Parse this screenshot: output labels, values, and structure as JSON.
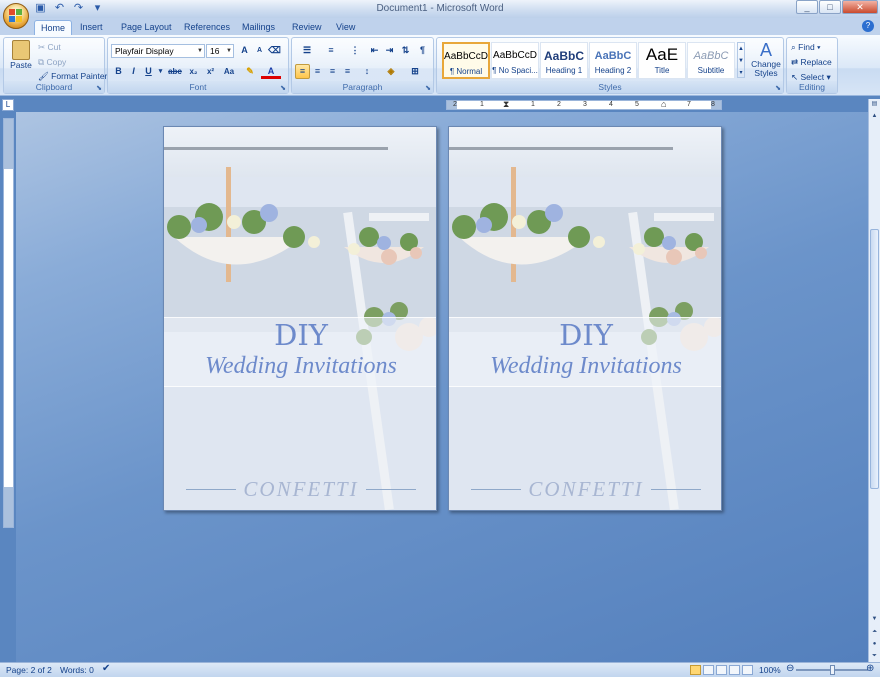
{
  "window": {
    "title": "Document1 - Microsoft Word",
    "controls": [
      "_",
      "□",
      "✕"
    ]
  },
  "quick_access": {
    "save_icon": "save-icon",
    "undo_icon": "undo-icon",
    "redo_icon": "redo-icon",
    "more": "▾"
  },
  "tabs": [
    {
      "label": "Home",
      "active": true
    },
    {
      "label": "Insert"
    },
    {
      "label": "Page Layout"
    },
    {
      "label": "References"
    },
    {
      "label": "Mailings"
    },
    {
      "label": "Review"
    },
    {
      "label": "View"
    }
  ],
  "ribbon": {
    "clipboard": {
      "label": "Clipboard",
      "paste": "Paste",
      "cut": "Cut",
      "copy": "Copy",
      "format_painter": "Format Painter"
    },
    "font": {
      "label": "Font",
      "font_name": "Playfair Display",
      "font_size": "16",
      "bold": "B",
      "italic": "I",
      "underline": "U",
      "strike": "abc",
      "subscript": "x₂",
      "superscript": "x²",
      "change_case": "Aa",
      "grow": "A",
      "shrink": "A"
    },
    "paragraph": {
      "label": "Paragraph",
      "show_marks": "¶"
    },
    "styles": {
      "label": "Styles",
      "items": [
        {
          "sample": "AaBbCcD",
          "name": "¶ Normal",
          "active": true
        },
        {
          "sample": "AaBbCcD",
          "name": "¶ No Spaci..."
        },
        {
          "sample": "AaBbC",
          "name": "Heading 1"
        },
        {
          "sample": "AaBbC",
          "name": "Heading 2"
        },
        {
          "sample": "AaE",
          "name": "Title"
        },
        {
          "sample": "AaBbC",
          "name": "Subtitle"
        }
      ],
      "change_styles": "Change Styles"
    },
    "editing": {
      "label": "Editing",
      "find": "Find",
      "replace": "Replace",
      "select": "Select"
    }
  },
  "ruler": {
    "marks": [
      "2",
      "1",
      "1",
      "2",
      "3",
      "4",
      "5",
      "6",
      "7",
      "8"
    ]
  },
  "pages": [
    {
      "title": "DIY",
      "subtitle": "Wedding Invitations",
      "brand": "CONFETTI"
    },
    {
      "title": "DIY",
      "subtitle": "Wedding Invitations",
      "brand": "CONFETTI"
    }
  ],
  "status": {
    "page": "Page: 2 of 2",
    "words": "Words: 0",
    "zoom": "100%",
    "zoom_level": 1.0
  },
  "colors": {
    "accent": "#6d8acb",
    "ribbon": "#dbe8f7",
    "workspace": "#5a86c0"
  }
}
